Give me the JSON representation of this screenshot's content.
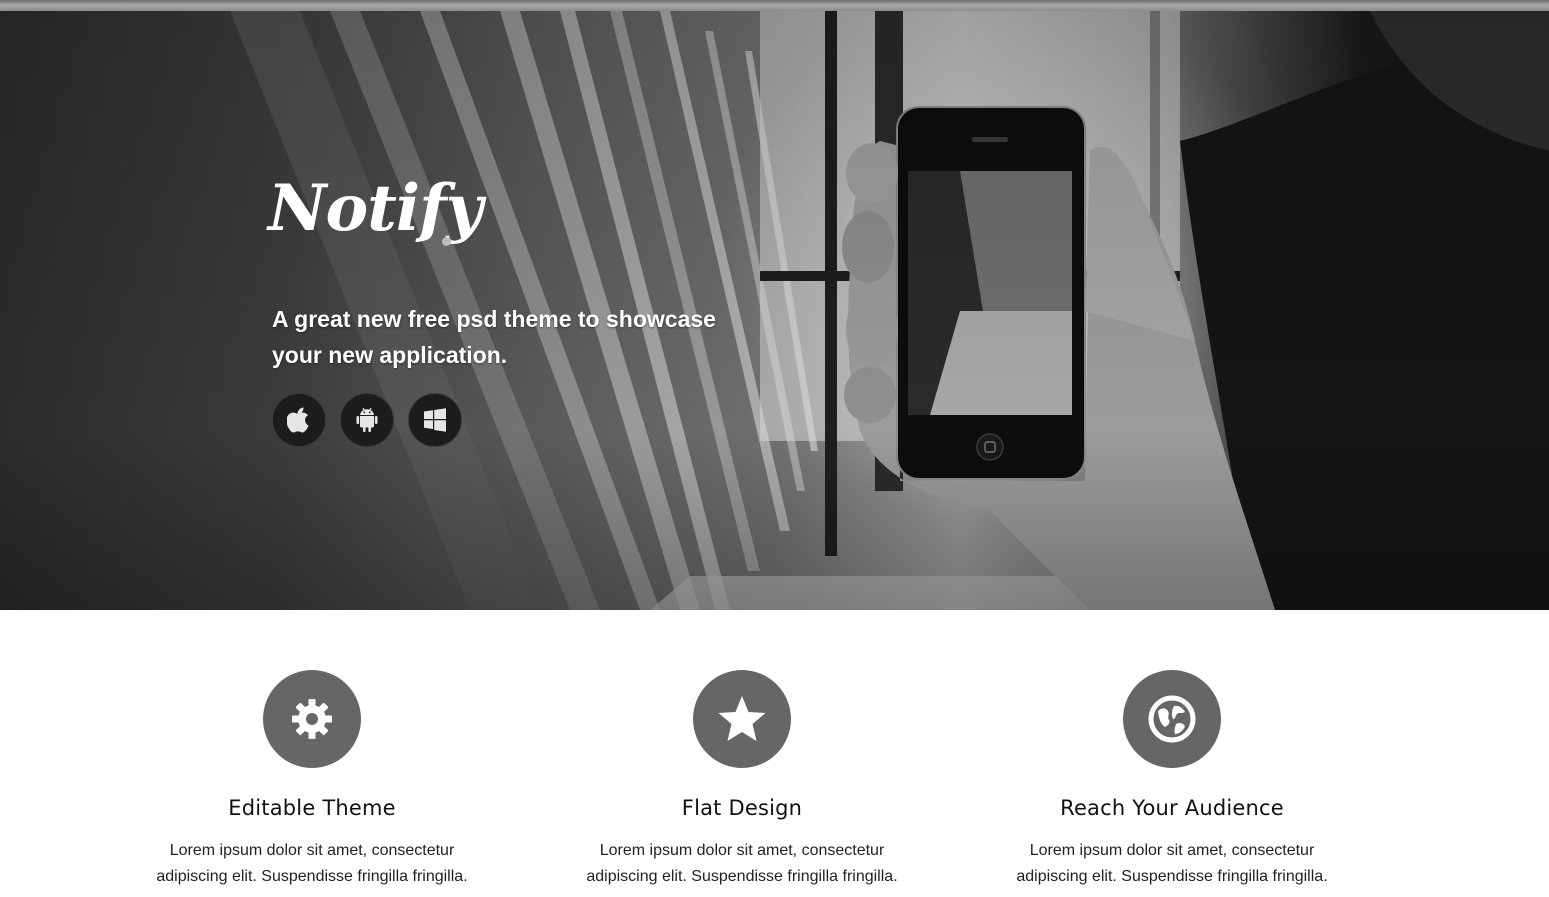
{
  "hero": {
    "logo_text": "Notify",
    "tagline_line1": "A great new free psd theme to showcase",
    "tagline_line2": "your new application.",
    "store_buttons": [
      {
        "icon": "apple-icon"
      },
      {
        "icon": "android-icon"
      },
      {
        "icon": "windows-icon"
      }
    ]
  },
  "features": [
    {
      "icon": "gear-icon",
      "title": "Editable Theme",
      "text": "Lorem ipsum dolor sit amet, consectetur adipiscing elit. Suspendisse fringilla fringilla."
    },
    {
      "icon": "star-icon",
      "title": "Flat Design",
      "text": "Lorem ipsum dolor sit amet, consectetur adipiscing elit. Suspendisse fringilla fringilla."
    },
    {
      "icon": "globe-icon",
      "title": "Reach Your Audience",
      "text": "Lorem ipsum dolor sit amet, consectetur adipiscing elit. Suspendisse fringilla fringilla."
    }
  ],
  "colors": {
    "icon_circle": "#666666",
    "store_button": "#1c1c1c"
  }
}
